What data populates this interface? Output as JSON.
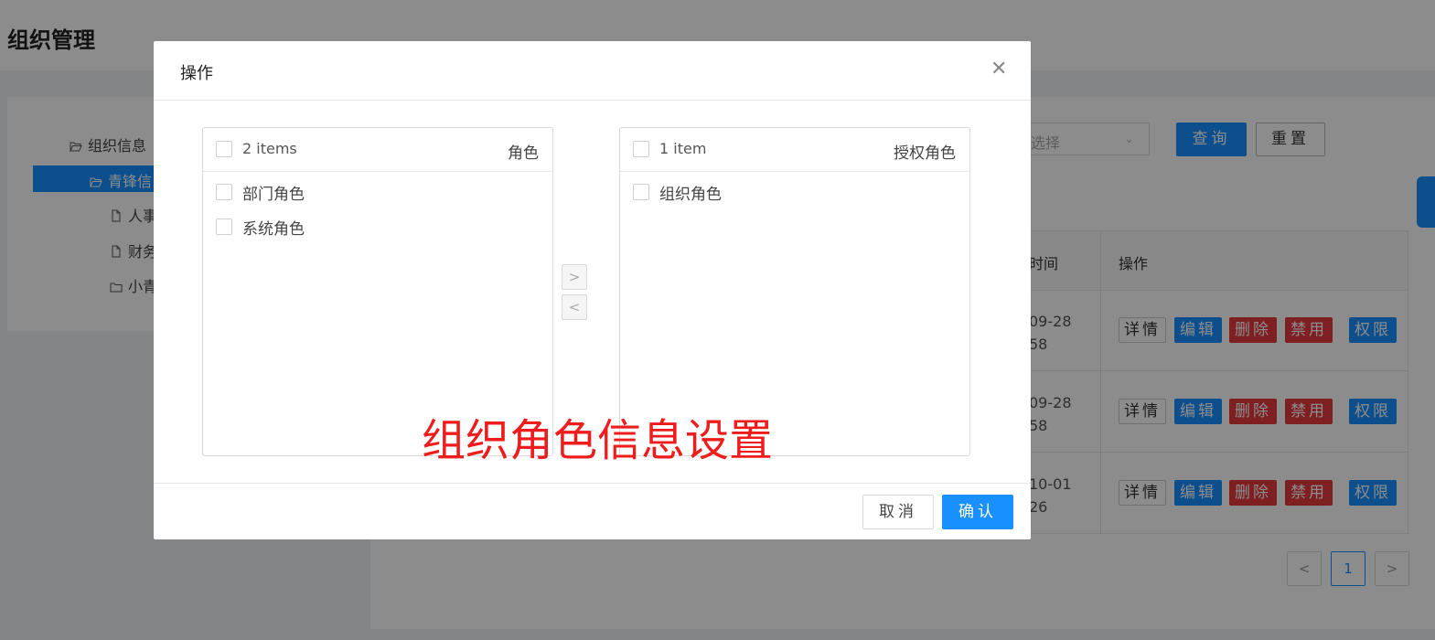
{
  "page": {
    "title": "组织管理"
  },
  "tree": {
    "nodes": [
      {
        "label": "组织信息",
        "icon": "folder-open-icon"
      },
      {
        "label": "青锋信",
        "icon": "folder-open-icon",
        "selected": true
      },
      {
        "label": "人事",
        "icon": "file-icon"
      },
      {
        "label": "财务",
        "icon": "file-icon"
      },
      {
        "label": "小青",
        "icon": "folder-icon"
      }
    ]
  },
  "filter": {
    "select_placeholder": "选择",
    "query_label": "查询",
    "reset_label": "重置"
  },
  "table": {
    "headers": {
      "time": "时间",
      "actions": "操作"
    },
    "rows": [
      {
        "time_line1": "09-28",
        "time_line2": "58"
      },
      {
        "time_line1": "09-28",
        "time_line2": "58"
      },
      {
        "time_line1": "10-01",
        "time_line2": "26"
      }
    ],
    "actions": {
      "detail": "详情",
      "edit": "编辑",
      "delete": "删除",
      "disable": "禁用",
      "permission": "权限"
    }
  },
  "pagination": {
    "prev": "<",
    "current": "1",
    "next": ">"
  },
  "modal": {
    "title": "操作",
    "close_glyph": "✕",
    "left_list": {
      "count_label": "2 items",
      "title": "角色",
      "items": [
        "部门角色",
        "系统角色"
      ]
    },
    "right_list": {
      "count_label": "1 item",
      "title": "授权角色",
      "items": [
        "组织角色"
      ]
    },
    "move_right": ">",
    "move_left": "<",
    "cancel_label": "取消",
    "ok_label": "确认"
  },
  "overlay_caption": "组织角色信息设置",
  "colors": {
    "primary": "#1890ff",
    "danger": "#e6393f",
    "caption": "#ee1c1c"
  }
}
